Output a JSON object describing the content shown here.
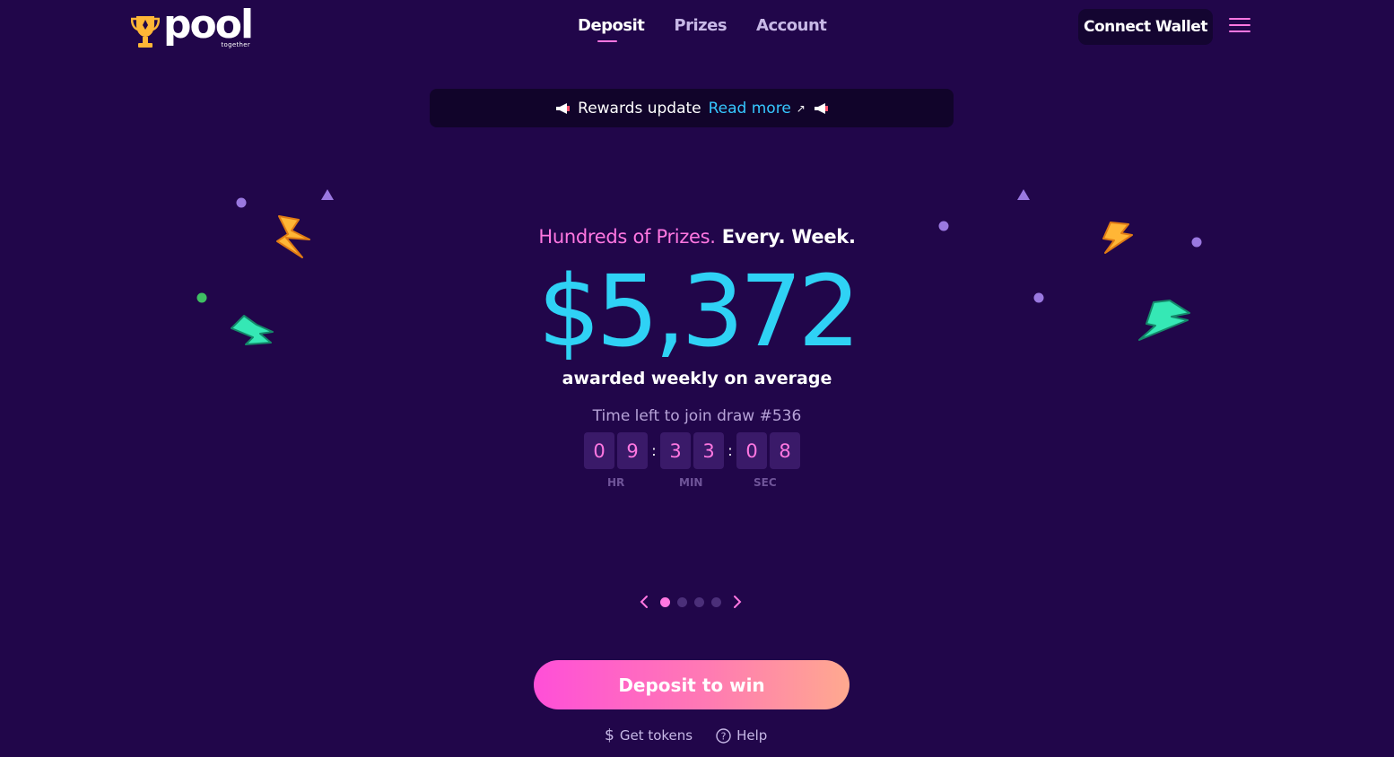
{
  "header": {
    "logo": {
      "word": "pool",
      "subtext": "together"
    },
    "nav": [
      {
        "label": "Deposit",
        "active": true
      },
      {
        "label": "Prizes",
        "active": false
      },
      {
        "label": "Account",
        "active": false
      }
    ],
    "connect_wallet_label": "Connect Wallet",
    "menu_icon": "hamburger-icon"
  },
  "banner": {
    "text": "Rewards update",
    "link_label": "Read more",
    "link_icon": "external-arrow-icon",
    "icon": "megaphone-icon"
  },
  "hero": {
    "headline_pink": "Hundreds of Prizes.",
    "headline_white": "Every. Week.",
    "amount": "$5,372",
    "amount_caption": "awarded weekly on average",
    "draw_label": "Time left to join draw #536",
    "countdown": {
      "hr": [
        "0",
        "9"
      ],
      "min": [
        "3",
        "3"
      ],
      "sec": [
        "0",
        "8"
      ],
      "labels": {
        "hr": "HR",
        "min": "MIN",
        "sec": "SEC"
      }
    }
  },
  "carousel": {
    "slides": 4,
    "active_index": 0
  },
  "cta": {
    "deposit_label": "Deposit to win",
    "get_tokens_label": "Get tokens",
    "help_label": "Help"
  },
  "colors": {
    "background": "#21064a",
    "accent_pink": "#ff77e1",
    "accent_cyan": "#2fd2f5",
    "button_dark": "#140531"
  }
}
